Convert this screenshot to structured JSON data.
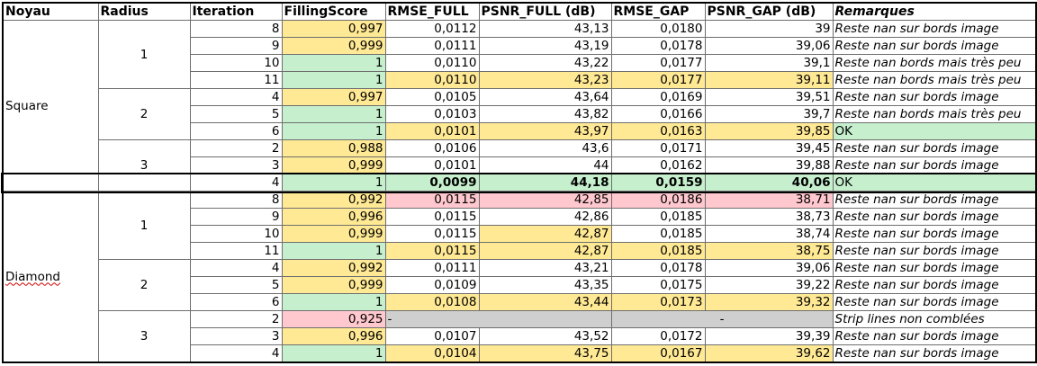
{
  "headers": {
    "noyau": "Noyau",
    "radius": "Radius",
    "iteration": "Iteration",
    "filling": "FillingScore",
    "rmse_full": "RMSE_FULL",
    "psnr_full": "PSNR_FULL (dB)",
    "rmse_gap": "RMSE_GAP",
    "psnr_gap": "PSNR_GAP (dB)",
    "remarks": "Remarques"
  },
  "groups": {
    "square": "Square",
    "diamond": "Diamond",
    "r1": "1",
    "r2": "2",
    "r3": "3",
    "r4": "1",
    "r5": "2",
    "r6": "3"
  },
  "rows": [
    {
      "it": "8",
      "fs": "0,997",
      "rf": "0,0112",
      "pf": "43,13",
      "rg": "0,0180",
      "pg": "39",
      "rem": "Reste nan sur bords image"
    },
    {
      "it": "9",
      "fs": "0,999",
      "rf": "0,0111",
      "pf": "43,19",
      "rg": "0,0178",
      "pg": "39,06",
      "rem": "Reste nan sur bords image"
    },
    {
      "it": "10",
      "fs": "1",
      "rf": "0,0110",
      "pf": "43,22",
      "rg": "0,0177",
      "pg": "39,1",
      "rem": "Reste nan bords mais très peu"
    },
    {
      "it": "11",
      "fs": "1",
      "rf": "0,0110",
      "pf": "43,23",
      "rg": "0,0177",
      "pg": "39,11",
      "rem": "Reste nan bords mais très peu"
    },
    {
      "it": "4",
      "fs": "0,997",
      "rf": "0,0105",
      "pf": "43,64",
      "rg": "0,0169",
      "pg": "39,51",
      "rem": "Reste nan sur bords image"
    },
    {
      "it": "5",
      "fs": "1",
      "rf": "0,0103",
      "pf": "43,82",
      "rg": "0,0166",
      "pg": "39,7",
      "rem": "Reste nan bords mais très peu"
    },
    {
      "it": "6",
      "fs": "1",
      "rf": "0,0101",
      "pf": "43,97",
      "rg": "0,0163",
      "pg": "39,85",
      "rem": "OK"
    },
    {
      "it": "2",
      "fs": "0,988",
      "rf": "0,0106",
      "pf": "43,6",
      "rg": "0,0171",
      "pg": "39,45",
      "rem": "Reste nan sur bords image"
    },
    {
      "it": "3",
      "fs": "0,999",
      "rf": "0,0101",
      "pf": "44",
      "rg": "0,0162",
      "pg": "39,88",
      "rem": "Reste nan sur bords image"
    },
    {
      "it": "4",
      "fs": "1",
      "rf": "0,0099",
      "pf": "44,18",
      "rg": "0,0159",
      "pg": "40,06",
      "rem": "OK"
    },
    {
      "it": "8",
      "fs": "0,992",
      "rf": "0,0115",
      "pf": "42,85",
      "rg": "0,0186",
      "pg": "38,71",
      "rem": "Reste nan sur bords image"
    },
    {
      "it": "9",
      "fs": "0,996",
      "rf": "0,0115",
      "pf": "42,86",
      "rg": "0,0185",
      "pg": "38,73",
      "rem": "Reste nan sur bords image"
    },
    {
      "it": "10",
      "fs": "0,999",
      "rf": "0,0115",
      "pf": "42,87",
      "rg": "0,0185",
      "pg": "38,74",
      "rem": "Reste nan sur bords image"
    },
    {
      "it": "11",
      "fs": "1",
      "rf": "0,0115",
      "pf": "42,87",
      "rg": "0,0185",
      "pg": "38,75",
      "rem": "Reste nan sur bords image"
    },
    {
      "it": "4",
      "fs": "0,992",
      "rf": "0,0111",
      "pf": "43,21",
      "rg": "0,0178",
      "pg": "39,06",
      "rem": "Reste nan sur bords image"
    },
    {
      "it": "5",
      "fs": "0,999",
      "rf": "0,0109",
      "pf": "43,35",
      "rg": "0,0175",
      "pg": "39,22",
      "rem": "Reste nan sur bords image"
    },
    {
      "it": "6",
      "fs": "1",
      "rf": "0,0108",
      "pf": "43,44",
      "rg": "0,0173",
      "pg": "39,32",
      "rem": "Reste nan sur bords image"
    },
    {
      "it": "2",
      "fs": "0,925",
      "rf": "-",
      "pf": "",
      "rg": "-",
      "pg": "",
      "rem": "Strip lines non comblées"
    },
    {
      "it": "3",
      "fs": "0,996",
      "rf": "0,0107",
      "pf": "43,52",
      "rg": "0,0172",
      "pg": "39,39",
      "rem": "Reste nan sur bords image"
    },
    {
      "it": "4",
      "fs": "1",
      "rf": "0,0104",
      "pf": "43,75",
      "rg": "0,0167",
      "pg": "39,62",
      "rem": "Reste nan sur bords image"
    }
  ],
  "colors": {
    "highlight_yellow": "#ffe994",
    "highlight_green": "#c6efce",
    "highlight_red": "#ffc7ce",
    "missing_gray": "#cfcfcf"
  }
}
